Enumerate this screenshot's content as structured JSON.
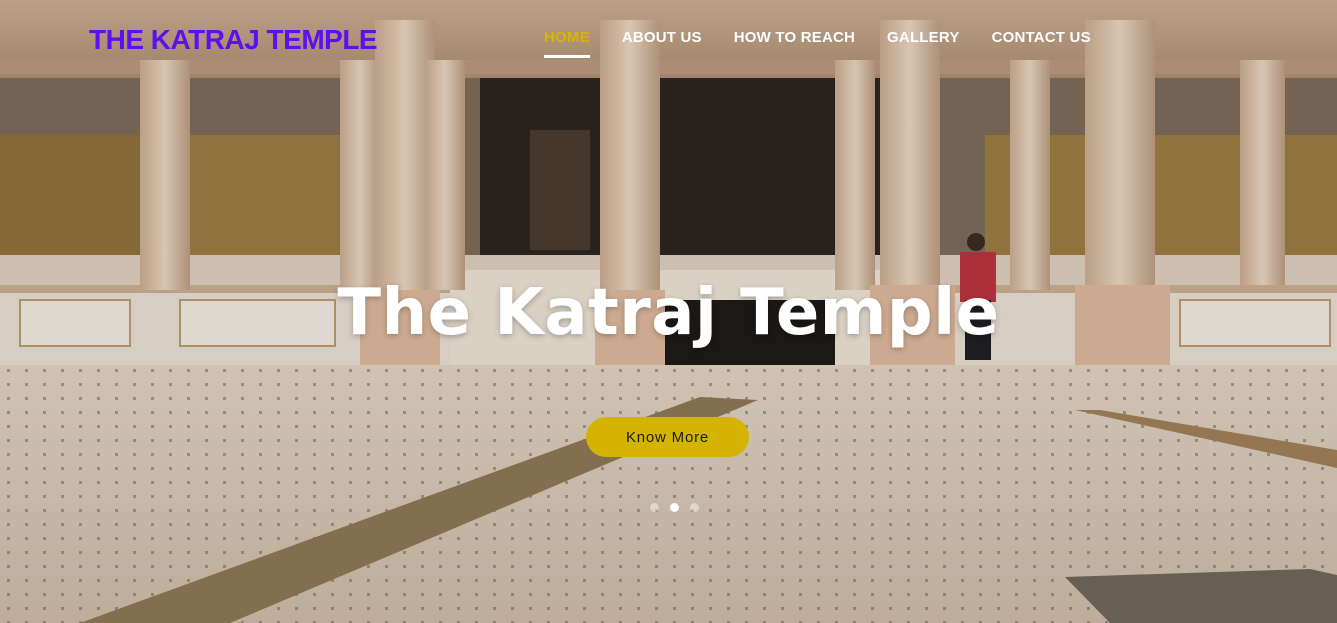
{
  "site": {
    "brand": "THE KATRAJ TEMPLE",
    "brand_color": "#5a10f0",
    "accent_color": "#d4b400"
  },
  "nav": {
    "items": [
      {
        "label": "HOME",
        "active": true
      },
      {
        "label": "ABOUT US",
        "active": false
      },
      {
        "label": "HOW TO REACH",
        "active": false
      },
      {
        "label": "GALLERY",
        "active": false
      },
      {
        "label": "CONTACT US",
        "active": false
      }
    ]
  },
  "hero": {
    "title": "The Katraj Temple",
    "cta_label": "Know More",
    "slides_total": 3,
    "active_slide": 2
  }
}
